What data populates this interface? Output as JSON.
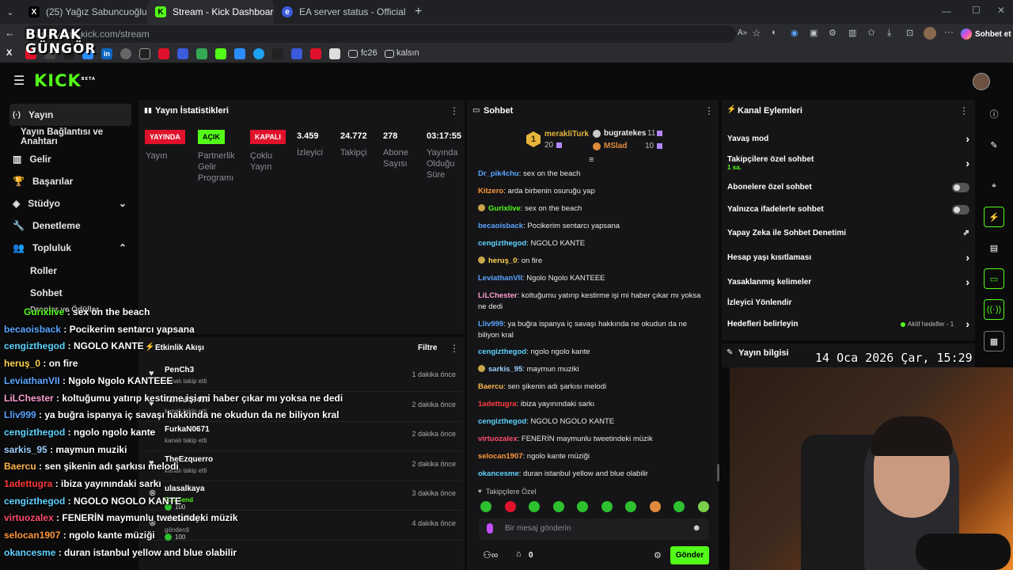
{
  "browser": {
    "tabs": [
      {
        "title": "(25) Yağız Sabuncuoğlu (@yagosab",
        "icon": "x-icon"
      },
      {
        "title": "Stream - Kick Dashboard",
        "icon": "kick-icon"
      },
      {
        "title": "EA server status - Official EA Help",
        "icon": "ea-icon"
      }
    ],
    "url": "dashboard.kick.com/stream",
    "profile_button": "Sohbet et",
    "bookmarks": [
      "fc26",
      "kalsın"
    ]
  },
  "watermark": {
    "line1": "BURAK",
    "line2": "GÜNGÖR"
  },
  "sidebar": {
    "items": [
      {
        "label": "Yayın",
        "icon": "broadcast-icon"
      },
      {
        "label": "Yayın Bağlantısı ve Anahtarı",
        "icon": ""
      },
      {
        "label": "Gelir",
        "icon": "chart-icon"
      },
      {
        "label": "Başarılar",
        "icon": "trophy-icon"
      },
      {
        "label": "Stüdyo",
        "icon": "layers-icon"
      },
      {
        "label": "Denetleme",
        "icon": "wrench-icon"
      },
      {
        "label": "Topluluk",
        "icon": "people-icon"
      },
      {
        "label": "Roller",
        "icon": ""
      },
      {
        "label": "Sohbet",
        "icon": ""
      },
      {
        "label": "Droplar ve Ödüller",
        "icon": ""
      }
    ]
  },
  "stats": {
    "title": "Yayın İstatistikleri",
    "badges": {
      "live": "YAYINDA",
      "on": "AÇIK",
      "off": "KAPALI"
    },
    "labels": {
      "live": "Yayın",
      "partner": "Partnerlik Gelir Programı",
      "multi": "Çoklu Yayın"
    },
    "viewers": {
      "value": "3.459",
      "label": "İzleyici"
    },
    "followers": {
      "value": "24.772",
      "label": "Takipçi"
    },
    "subs": {
      "value": "278",
      "label": "Abone Sayısı"
    },
    "uptime": {
      "value": "03:17:55",
      "label": "Yayında Olduğu Süre"
    }
  },
  "activity": {
    "title": "Etkinlik Akışı",
    "filter": "Filtre",
    "rows": [
      {
        "name": "PenCh3",
        "sub": "kanalı takip etti",
        "time": "1 dakika önce"
      },
      {
        "name": "kamalo3455",
        "sub": "kanalı takip etti",
        "time": "2 dakika önce"
      },
      {
        "name": "FurkaN0671",
        "sub": "kanalı takip etti",
        "time": "2 dakika önce"
      },
      {
        "name": "TheEzquerro",
        "sub": "kanalı takip etti",
        "time": "2 dakika önce"
      },
      {
        "name": "ulasalkaya",
        "sub": "Full Send",
        "extra": "100",
        "time": "3 dakika önce"
      },
      {
        "name": "ulasalkaya",
        "sub": "gönderdi",
        "extra": "100",
        "time": "4 dakika önce"
      }
    ]
  },
  "chat": {
    "title": "Sohbet",
    "leaderboard": [
      {
        "rank": "1",
        "name": "merakliTurk",
        "count": "20"
      },
      {
        "name": "bugratekes",
        "count": "11"
      },
      {
        "name": "MSlad",
        "count": "10"
      }
    ],
    "messages": [
      {
        "user": "Dr_pik4chu",
        "color": "#5aa5ff",
        "text": "sex on the beach"
      },
      {
        "user": "Kitzero",
        "color": "#ff9a3c",
        "text": "arda birbenin osuruğu yap"
      },
      {
        "user": "Gurixlive",
        "color": "#53fc18",
        "text": "sex on the beach"
      },
      {
        "user": "becaoisback",
        "color": "#5aa5ff",
        "text": "Pocikerim sentarcı yapsana"
      },
      {
        "user": "cengizthegod",
        "color": "#5fd3ff",
        "text": "NGOLO KANTE"
      },
      {
        "user": "heruş_0",
        "color": "#ffd34d",
        "text": "on fire"
      },
      {
        "user": "LeviathanVII",
        "color": "#5aa5ff",
        "text": "Ngolo Ngolo KANTEEE"
      },
      {
        "user": "LiLChester",
        "color": "#ff9ed1",
        "text": "koltuğumu yatırıp kestirme işi mi haber çıkar mı yoksa ne dedi"
      },
      {
        "user": "Lliv999",
        "color": "#5aa5ff",
        "text": "ya buğra ispanya iç savaşı hakkında ne okudun da ne biliyon kral"
      },
      {
        "user": "cengizthegod",
        "color": "#5fd3ff",
        "text": "ngolo ngolo kante"
      },
      {
        "user": "sarkis_95",
        "color": "#9fd0ff",
        "text": "maymun muziki"
      },
      {
        "user": "Baercu",
        "color": "#ffb84d",
        "text": "sen şikenin adı şarkısı melodi"
      },
      {
        "user": "1adettugra",
        "color": "#ff3b3b",
        "text": "ibiza yayınındaki sarkı"
      },
      {
        "user": "cengizthegod",
        "color": "#5fd3ff",
        "text": "NGOLO NGOLO KANTE"
      },
      {
        "user": "virtuozalex",
        "color": "#ff4d6d",
        "text": "FENERİN maymunlu tweetindeki müzik"
      },
      {
        "user": "selocan1907",
        "color": "#ff9a3c",
        "text": "ngolo kante müziği"
      },
      {
        "user": "okancesme",
        "color": "#5fd3ff",
        "text": "duran istanbul yellow and blue olabilir"
      }
    ],
    "followers_only_label": "Takipçilere Özel",
    "input_placeholder": "Bir mesaj gönderin",
    "send_label": "Gönder",
    "footer_count": "0"
  },
  "overlay_chat": [
    {
      "user": "Gurixlive",
      "color": "#53fc18",
      "text": "sex on the beach"
    },
    {
      "user": "becaoisback",
      "color": "#5aa5ff",
      "text": "Pocikerim sentarcı yapsana"
    },
    {
      "user": "cengizthegod",
      "color": "#5fd3ff",
      "text": "NGOLO KANTE"
    },
    {
      "user": "heruş_0",
      "color": "#ffd34d",
      "text": "on fire"
    },
    {
      "user": "LeviathanVII",
      "color": "#5aa5ff",
      "text": "Ngolo Ngolo KANTEEE"
    },
    {
      "user": "LiLChester",
      "color": "#ff9ed1",
      "text": "koltuğumu yatırıp kestirme işi mi haber çıkar mı yoksa ne dedi"
    },
    {
      "user": "Lliv999",
      "color": "#5aa5ff",
      "text": "ya buğra ispanya iç savaşı hakkında ne okudun da ne biliyon kral"
    },
    {
      "user": "cengizthegod",
      "color": "#5fd3ff",
      "text": "ngolo ngolo kante"
    },
    {
      "user": "sarkis_95",
      "color": "#9fd0ff",
      "text": "maymun muziki"
    },
    {
      "user": "Baercu",
      "color": "#ffb84d",
      "text": "sen şikenin adı şarkısı melodi"
    },
    {
      "user": "1adettugra",
      "color": "#ff3b3b",
      "text": "ibiza yayınındaki sarkı"
    },
    {
      "user": "cengizthegod",
      "color": "#5fd3ff",
      "text": "NGOLO NGOLO KANTE"
    },
    {
      "user": "virtuozalex",
      "color": "#ff4d6d",
      "text": "FENERİN maymunlu tweetindeki müzik"
    },
    {
      "user": "selocan1907",
      "color": "#ff9a3c",
      "text": "ngolo kante müziği"
    },
    {
      "user": "okancesme",
      "color": "#5fd3ff",
      "text": "duran istanbul yellow and blue olabilir"
    }
  ],
  "channel_actions": {
    "title": "Kanal Eylemleri",
    "rows": [
      {
        "label": "Yavaş mod",
        "control": "chevron"
      },
      {
        "label": "Takipçilere özel sohbet",
        "sub": "1 sa.",
        "control": "chevron"
      },
      {
        "label": "Abonelere özel sohbet",
        "control": "toggle"
      },
      {
        "label": "Yalnızca ifadelerle sohbet",
        "control": "toggle"
      },
      {
        "label": "Yapay Zeka ile Sohbet Denetimi",
        "control": "external"
      },
      {
        "label": "Hesap yaşı kısıtlaması",
        "control": "chevron"
      },
      {
        "label": "Yasaklanmış kelimeler",
        "control": "chevron"
      },
      {
        "label": "İzleyici Yönlendir",
        "control": "none"
      },
      {
        "label": "Hedefleri belirleyin",
        "status": "Aktif hedefler - 1",
        "control": "chevron"
      }
    ]
  },
  "stream_info": {
    "title": "Yayın bilgisi"
  },
  "clock": "14 Oca 2026 Çar, 15:29",
  "colors": {
    "accent": "#53fc18",
    "live_red": "#e0122b",
    "panel": "#151517",
    "bg": "#0b0b0c"
  }
}
